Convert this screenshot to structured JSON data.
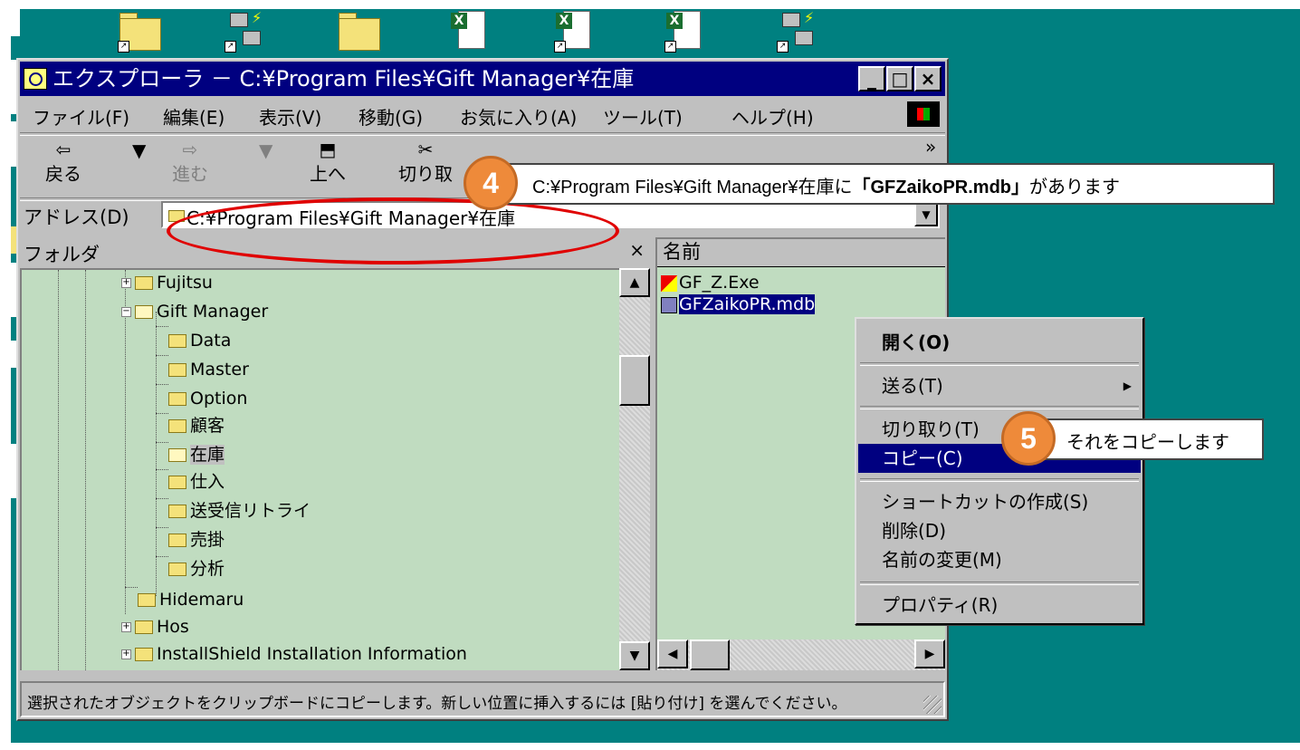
{
  "window": {
    "title": "エクスプローラ － C:¥Program Files¥Gift Manager¥在庫",
    "minimize": "_",
    "maximize": "□",
    "close": "×"
  },
  "menu": [
    "ファイル(F)",
    "編集(E)",
    "表示(V)",
    "移動(G)",
    "お気に入り(A)",
    "ツール(T)",
    "ヘルプ(H)"
  ],
  "toolbar": {
    "back": "戻る",
    "forward": "進む",
    "up": "上へ",
    "cut": "切り取",
    "more": "»"
  },
  "address": {
    "label": "アドレス(D)",
    "value": "C:¥Program Files¥Gift Manager¥在庫"
  },
  "folder_pane": {
    "title": "フォルダ",
    "close": "×",
    "tree": [
      {
        "label": "Fujitsu",
        "expander": "+"
      },
      {
        "label": "Gift Manager",
        "expander": "−"
      },
      {
        "label": "Data"
      },
      {
        "label": "Master"
      },
      {
        "label": "Option"
      },
      {
        "label": "顧客"
      },
      {
        "label": "在庫"
      },
      {
        "label": "仕入"
      },
      {
        "label": "送受信リトライ"
      },
      {
        "label": "売掛"
      },
      {
        "label": "分析"
      },
      {
        "label": "Hidemaru"
      },
      {
        "label": "Hos",
        "expander": "+"
      },
      {
        "label": "InstallShield Installation Information",
        "expander": "+"
      }
    ]
  },
  "file_pane": {
    "column_name": "名前",
    "files": [
      "GF_Z.Exe",
      "GFZaikoPR.mdb"
    ]
  },
  "context_menu": {
    "open": "開く(O)",
    "send_to": "送る(T)",
    "cut": "切り取り(T)",
    "copy": "コピー(C)",
    "create_shortcut": "ショートカットの作成(S)",
    "delete": "削除(D)",
    "rename": "名前の変更(M)",
    "properties": "プロパティ(R)"
  },
  "status_text": "選択されたオブジェクトをクリップボードにコピーします。新しい位置に挿入するには [貼り付け] を選んでください。",
  "annotations": {
    "step4": {
      "number": "4",
      "text_before": "C:¥Program Files¥Gift Manager¥在庫に",
      "text_bold": "「GFZaikoPR.mdb」",
      "text_after": "があります"
    },
    "step5": {
      "number": "5",
      "text": "それをコピーします"
    }
  },
  "colors": {
    "desktop": "#008080",
    "titlebar": "#000080",
    "highlight": "#000080",
    "tree_bg": "#c0dcc0",
    "annotation_red": "#e00000",
    "badge_orange": "#ee8a3a"
  }
}
